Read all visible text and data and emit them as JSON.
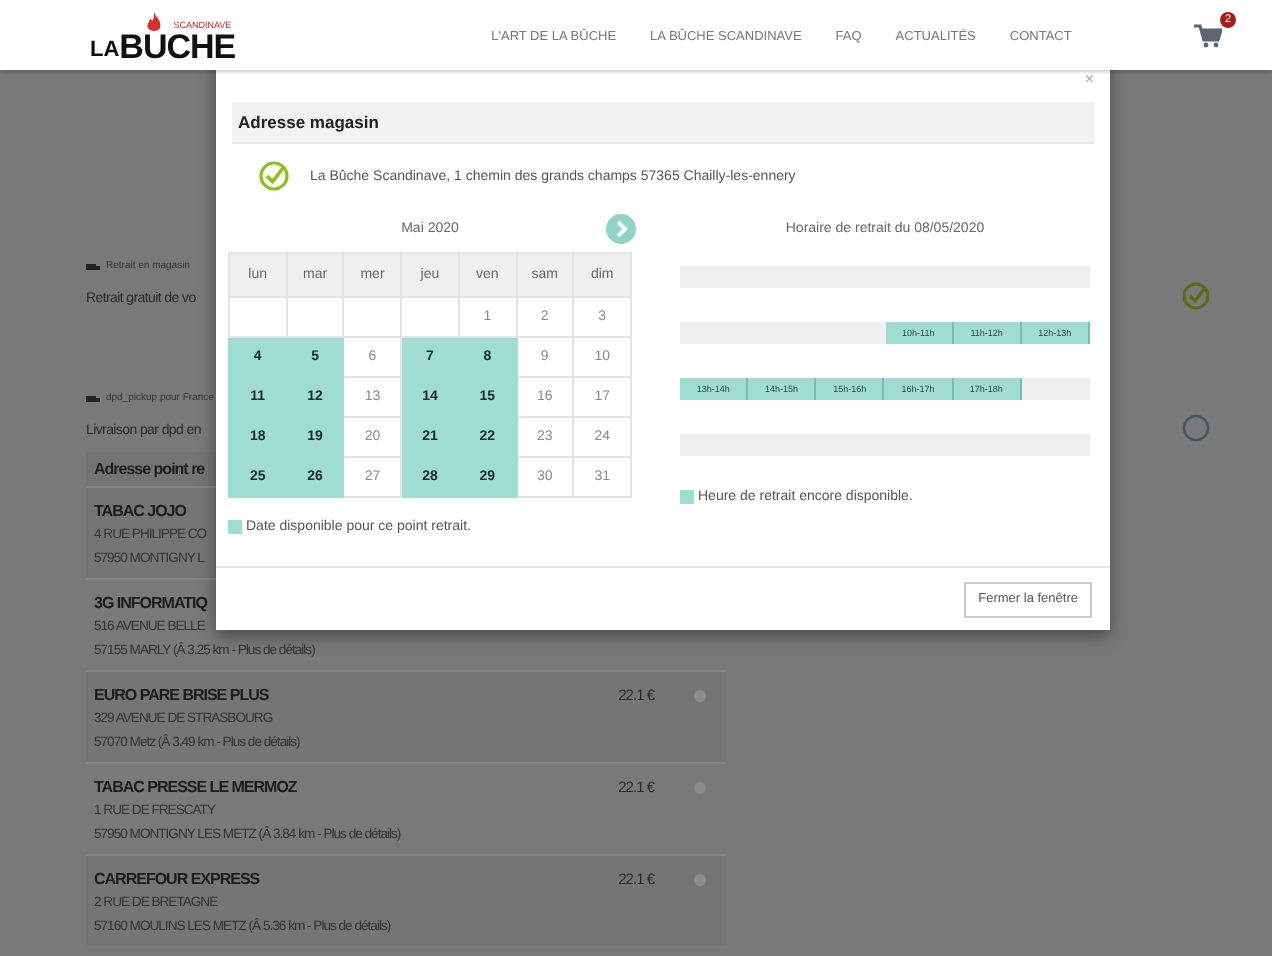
{
  "header": {
    "logo": {
      "tagline": "SCANDINAVE",
      "prefix": "LA",
      "name": "BUCHE"
    },
    "nav": [
      "L'ART DE LA BÛCHE",
      "LA BÛCHE SCANDINAVE",
      "FAQ",
      "ACTUALITÉS",
      "CONTACT"
    ],
    "cart_count": "2"
  },
  "page": {
    "options": [
      {
        "label": "Retrait en magasin",
        "text": "Retrait gratuit de vo",
        "selected": true
      },
      {
        "label": "dpd_pickup pour France",
        "text": "Livraison par dpd en",
        "selected": false
      }
    ],
    "table": {
      "header": "Adresse point re",
      "rows": [
        {
          "name": "TABAC JOJO",
          "address": "4 RUE PHILIPPE CO",
          "city": "57950 MONTIGNY L"
        },
        {
          "name": "3G INFORMATIQ",
          "address": "516 AVENUE BELLE",
          "city": "57155 MARLY (Â  3.25 km - Plus de détails)"
        },
        {
          "name": "EURO PARE BRISE PLUS",
          "address": "329 AVENUE DE STRASBOURG",
          "city": "57070 Metz (Â  3.49 km - Plus de détails)",
          "price": "22.1 €",
          "selected": false
        },
        {
          "name": "TABAC PRESSE LE MERMOZ",
          "address": "1 RUE DE FRESCATY",
          "city": "57950 MONTIGNY LES METZ (Â  3.84 km - Plus de détails)",
          "price": "22.1 €",
          "selected": false
        },
        {
          "name": "CARREFOUR EXPRESS",
          "address": "2 RUE DE BRETAGNE",
          "city": "57160 MOULINS LES METZ (Â  5.36 km - Plus de détails)",
          "price": "22.1 €",
          "selected": false
        }
      ]
    }
  },
  "modal": {
    "close": "×",
    "section_title": "Adresse magasin",
    "address": "La Bûche Scandinave, 1 chemin des grands champs 57365 Chailly-les-ennery",
    "calendar": {
      "month": "Mai 2020",
      "weekdays": [
        "lun",
        "mar",
        "mer",
        "jeu",
        "ven",
        "sam",
        "dim"
      ],
      "weeks": [
        [
          {
            "day": "1",
            "available": false
          },
          {
            "day": "2",
            "available": false
          },
          {
            "day": "3",
            "available": false
          }
        ],
        [
          {
            "day": "4",
            "available": true
          },
          {
            "day": "5",
            "available": true
          },
          {
            "day": "6",
            "available": false
          },
          {
            "day": "7",
            "available": true
          },
          {
            "day": "8",
            "available": true
          },
          {
            "day": "9",
            "available": false
          },
          {
            "day": "10",
            "available": false
          }
        ],
        [
          {
            "day": "11",
            "available": true
          },
          {
            "day": "12",
            "available": true
          },
          {
            "day": "13",
            "available": false
          },
          {
            "day": "14",
            "available": true
          },
          {
            "day": "15",
            "available": true
          },
          {
            "day": "16",
            "available": false
          },
          {
            "day": "17",
            "available": false
          }
        ],
        [
          {
            "day": "18",
            "available": true
          },
          {
            "day": "19",
            "available": true
          },
          {
            "day": "20",
            "available": false
          },
          {
            "day": "21",
            "available": true
          },
          {
            "day": "22",
            "available": true
          },
          {
            "day": "23",
            "available": false
          },
          {
            "day": "24",
            "available": false
          }
        ],
        [
          {
            "day": "25",
            "available": true
          },
          {
            "day": "26",
            "available": true
          },
          {
            "day": "27",
            "available": false
          },
          {
            "day": "28",
            "available": true
          },
          {
            "day": "29",
            "available": true
          },
          {
            "day": "30",
            "available": false
          },
          {
            "day": "31",
            "available": false
          }
        ]
      ],
      "legend": "Date disponible pour ce point retrait."
    },
    "schedule": {
      "title": "Horaire de retrait du 08/05/2020",
      "rows": [
        {
          "kind": "empty"
        },
        {
          "kind": "end",
          "slots": [
            "10h-11h",
            "11h-12h",
            "12h-13h"
          ]
        },
        {
          "kind": "start",
          "slots": [
            "13h-14h",
            "14h-15h",
            "15h-16h",
            "16h-17h",
            "17h-18h"
          ]
        },
        {
          "kind": "empty"
        }
      ],
      "legend": "Heure de retrait encore disponible."
    },
    "button": "Fermer la fenêtre"
  }
}
